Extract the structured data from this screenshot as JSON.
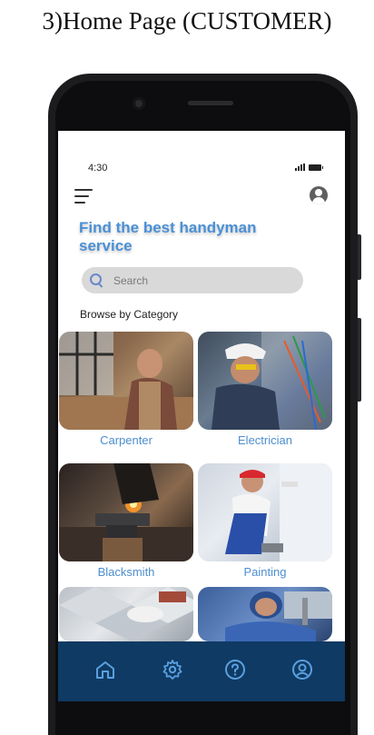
{
  "document": {
    "title": "3)Home Page (CUSTOMER)"
  },
  "status_bar": {
    "time": "4:30"
  },
  "header": {
    "headline": "Find the best handyman service"
  },
  "search": {
    "placeholder": "Search"
  },
  "categories": {
    "label": "Browse by Category",
    "items": [
      {
        "label": "Carpenter"
      },
      {
        "label": "Electrician"
      },
      {
        "label": "Blacksmith"
      },
      {
        "label": "Painting"
      },
      {
        "label": ""
      },
      {
        "label": ""
      }
    ]
  },
  "bottom_nav": {
    "items": [
      {
        "icon": "home-icon"
      },
      {
        "icon": "settings-icon"
      },
      {
        "icon": "help-icon"
      },
      {
        "icon": "profile-icon"
      }
    ]
  },
  "colors": {
    "accent_text": "#4a90d6",
    "nav_background": "#0f3a63",
    "nav_icon": "#5aa0e0",
    "search_background": "#d9d9d9"
  }
}
